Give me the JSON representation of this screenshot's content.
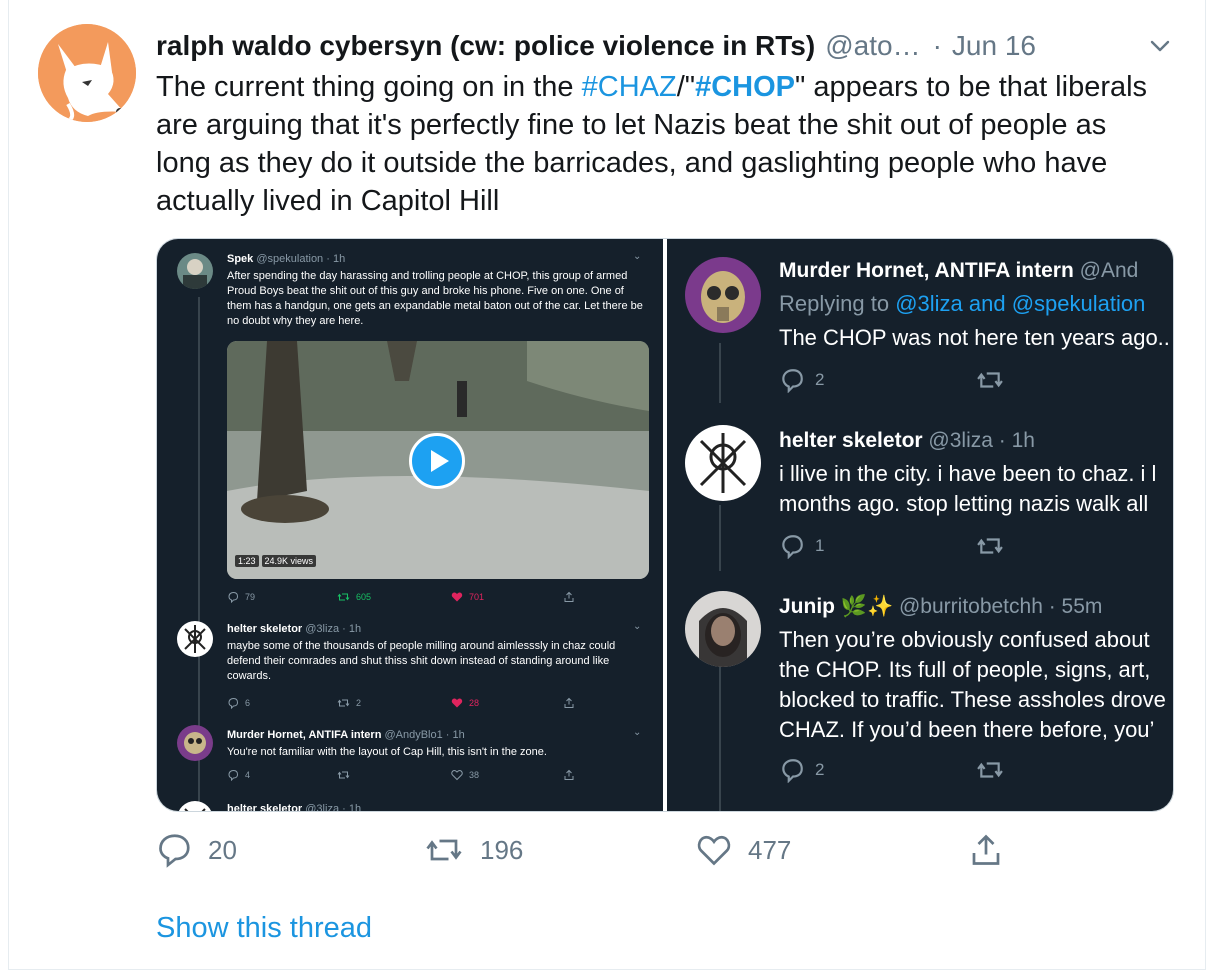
{
  "tweet": {
    "name": "ralph waldo cybersyn (cw: police violence in RTs)",
    "handle": "@ato…",
    "dot": "·",
    "date": "Jun 16",
    "text_parts": {
      "t1": "The current thing going on in the ",
      "hash1": "#CHAZ",
      "t2": "/\"",
      "hash2": "#CHOP",
      "t3": "\" appears to be that liberals are arguing that it's perfectly fine to let Nazis beat the shit out of people as long as they do it outside the barricades, and gaslighting people who have actually lived in Capitol Hill"
    },
    "actions": {
      "replies": "20",
      "retweets": "196",
      "likes": "477"
    },
    "show_thread": "Show this thread"
  },
  "screenshot_left": {
    "tweet1": {
      "name": "Spek",
      "meta": "@spekulation · 1h",
      "body": "After spending the day harassing and trolling people at CHOP, this group of armed Proud Boys beat the shit out of this guy and broke his phone. Five on one. One of them has a handgun, one gets an expandable metal baton out of the car. Let there be no doubt why they are here.",
      "video_time": "1:23",
      "video_views": "24.9K views",
      "replies": "79",
      "retweets": "605",
      "likes": "701"
    },
    "tweet2": {
      "name": "helter skeletor",
      "meta": "@3liza · 1h",
      "body": "maybe some of the thousands of people milling around aimlesssly in chaz could defend their comrades and shut thiss shit down instead of standing around like cowards.",
      "replies": "6",
      "retweets": "2",
      "likes": "28"
    },
    "tweet3": {
      "name": "Murder Hornet, ANTIFA intern",
      "meta": "@AndyBlo1 · 1h",
      "body": "You're not familiar with the layout of Cap Hill, this isn't in the zone.",
      "replies": "4",
      "retweets": "",
      "likes": "38"
    },
    "tweet4": {
      "name": "helter skeletor",
      "meta": "@3liza · 1h"
    }
  },
  "screenshot_right": {
    "tweet1": {
      "name": "Murder Hornet, ANTIFA intern",
      "handle": "@And",
      "replying_prefix": "Replying to ",
      "replying_to": "@3liza and @spekulation",
      "body": "The CHOP was not here ten years ago..",
      "replies": "2"
    },
    "tweet2": {
      "name": "helter skeletor",
      "meta": "@3liza · 1h",
      "line1": "i llive in the city. i have been to chaz. i l",
      "line2": "months ago. stop letting nazis walk all",
      "replies": "1"
    },
    "tweet3": {
      "name": "Junip",
      "emoji": "🌿✨",
      "meta": "@burritobetchh · 55m",
      "line1": "Then you’re obviously confused about",
      "line2": "the CHOP. Its full of people, signs, art,",
      "line3": "blocked to traffic. These assholes drove",
      "line4": "CHAZ. If you’d been there before, you’",
      "replies": "2"
    }
  },
  "colors": {
    "link_blue": "#1b95e0",
    "dark_bg": "#15202b",
    "like_pink": "#e0245e",
    "retweet_green": "#17bf63",
    "grey_text": "#657786"
  },
  "icons": [
    "fox-avatar-icon",
    "chevron-down-icon",
    "reply-icon",
    "retweet-icon",
    "like-icon",
    "share-icon",
    "play-icon"
  ]
}
